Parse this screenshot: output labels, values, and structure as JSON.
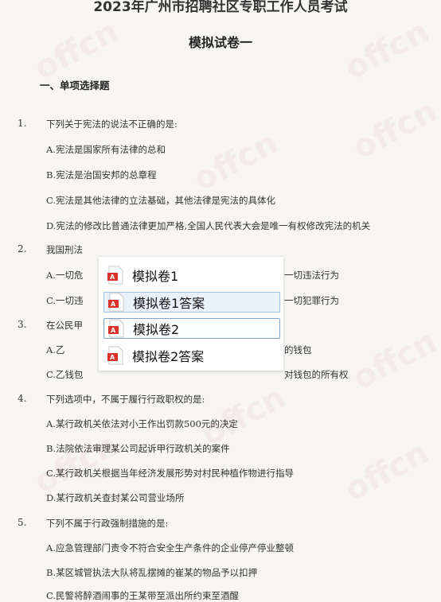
{
  "document": {
    "header_title": "2023年广州市招聘社区专职工作人员考试",
    "subtitle": "模拟试卷一",
    "section_title": "一、单项选择题"
  },
  "watermark": "offcn",
  "questions": [
    {
      "number": "1.",
      "stem": "下列关于宪法的说法不正确的是:",
      "options": [
        "A.宪法是国家所有法律的总和",
        "B.宪法是治国安邦的总章程",
        "C.宪法是其他法律的立法基础，其他法律是宪法的具体化",
        "D.宪法的修改比普通法律更加严格,全国人民代表大会是唯一有权修改宪法的机关"
      ]
    },
    {
      "number": "2.",
      "stem": "我国刑法",
      "options": [
        "A.一切危",
        "C.一切违"
      ],
      "options_right": [
        "一切违法行为",
        "一切犯罪行为"
      ]
    },
    {
      "number": "3.",
      "stem": "在公民甲",
      "options": [
        "A.乙",
        "C.乙钱包"
      ],
      "options_right": [
        "的钱包",
        "对钱包的所有权"
      ]
    },
    {
      "number": "4.",
      "stem": "下列选项中，不属于履行行政职权的是:",
      "options": [
        "A.某行政机关依法对小王作出罚款500元的决定",
        "B.法院依法审理某公司起诉甲行政机关的案件",
        "C.某行政机关根据当年经济发展形势对村民种植作物进行指导",
        "D.某行政机关查封某公司营业场所"
      ]
    },
    {
      "number": "5.",
      "stem": "下列不属于行政强制措施的是:",
      "options": [
        "A.应急管理部门责令不符合安全生产条件的企业停产停业整顿",
        "B.某区城管执法大队将乱摆摊的崔某的物品予以扣押",
        "C.民警将醉酒闹事的王某带至派出所约束至酒醒"
      ]
    }
  ],
  "file_popup": {
    "items": [
      {
        "name": "模拟卷1",
        "icon": "pdf-icon"
      },
      {
        "name": "模拟卷1答案",
        "icon": "pdf-icon"
      },
      {
        "name": "模拟卷2",
        "icon": "pdf-icon"
      },
      {
        "name": "模拟卷2答案",
        "icon": "pdf-icon"
      }
    ],
    "hovered_index": 1,
    "selected_index": 2,
    "colors": {
      "pdf_red": "#d9322a",
      "hover_bg": "#e9f1fb",
      "hover_border": "#9fc1e6"
    }
  }
}
